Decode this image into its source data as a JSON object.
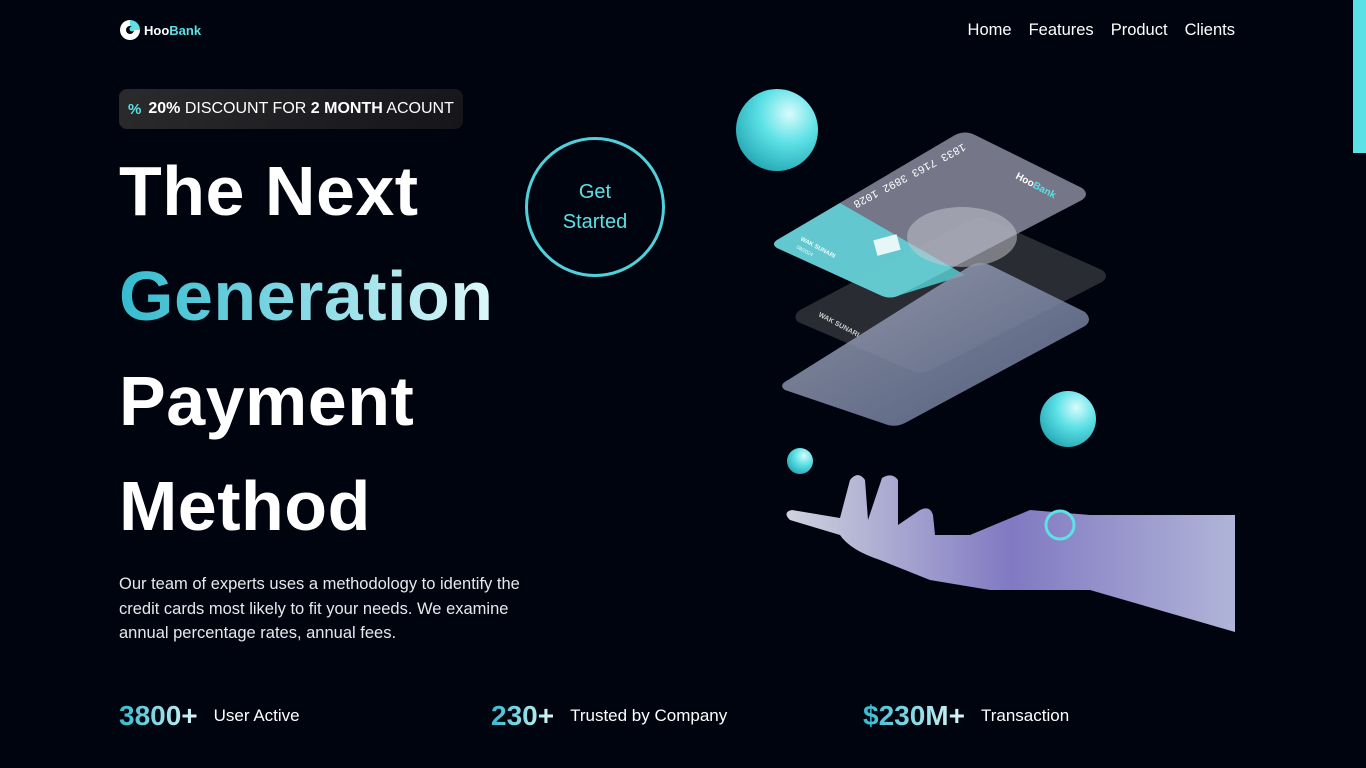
{
  "nav": {
    "logo": {
      "hoo": "Hoo",
      "bank": "Bank"
    },
    "items": [
      "Home",
      "Features",
      "Product",
      "Clients"
    ]
  },
  "badge": {
    "icon": "percent-icon",
    "percent": "20%",
    "text1": "DISCOUNT FOR",
    "months": "2 MONTH",
    "text2": "ACOUNT"
  },
  "heading": {
    "line1": "The Next",
    "line2": "Generation",
    "line3": "Payment",
    "line4": "Method"
  },
  "cta": {
    "line1": "Get",
    "line2": "Started"
  },
  "description": "Our team of experts uses a methodology to identify the credit cards most likely to fit your needs. We examine annual percentage rates, annual fees.",
  "hero_image": {
    "card_number": "1833 7163 3892 1028",
    "card_holder": "WAK SUNARI",
    "card_expiry": "08/2024",
    "card_brand_hoo": "Hoo",
    "card_brand_bank": "Bank"
  },
  "stats": [
    {
      "value": "3800+",
      "label": "User Active"
    },
    {
      "value": "230+",
      "label": "Trusted by Company"
    },
    {
      "value": "$230M+",
      "label": "Transaction"
    }
  ],
  "colors": {
    "background": "#00040f",
    "accent": "#5ce1e6"
  }
}
